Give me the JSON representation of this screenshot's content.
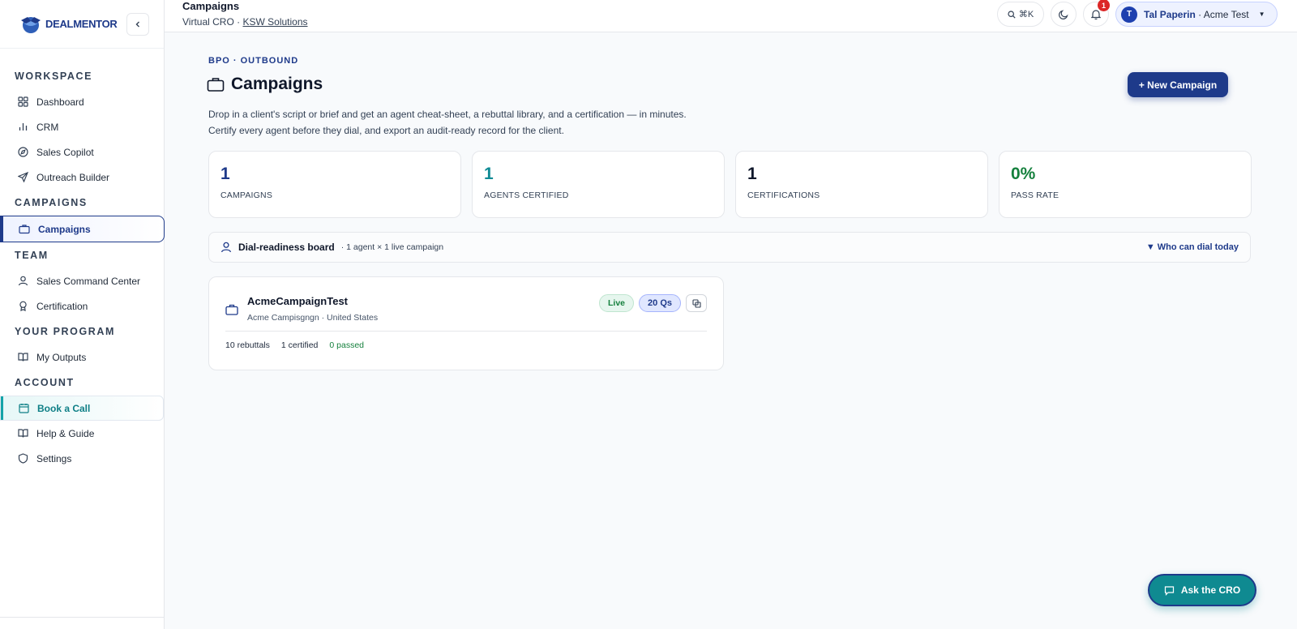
{
  "brand": {
    "logo_text": "DEALMENTOR"
  },
  "sidebar": {
    "sections": [
      {
        "title": "WORKSPACE",
        "items": [
          {
            "label": "Dashboard",
            "icon": "grid-icon"
          },
          {
            "label": "CRM",
            "icon": "bar-chart-icon"
          },
          {
            "label": "Sales Copilot",
            "icon": "compass-icon"
          },
          {
            "label": "Outreach Builder",
            "icon": "send-icon"
          }
        ]
      },
      {
        "title": "CAMPAIGNS",
        "items": [
          {
            "label": "Campaigns",
            "icon": "briefcase-icon",
            "active": true
          }
        ]
      },
      {
        "title": "TEAM",
        "items": [
          {
            "label": "Sales Command Center",
            "icon": "user-icon"
          },
          {
            "label": "Certification",
            "icon": "award-icon"
          }
        ]
      },
      {
        "title": "YOUR PROGRAM",
        "items": [
          {
            "label": "My Outputs",
            "icon": "book-open-icon"
          }
        ]
      },
      {
        "title": "ACCOUNT",
        "items": [
          {
            "label": "Book a Call",
            "icon": "calendar-icon",
            "highlight": true
          },
          {
            "label": "Help & Guide",
            "icon": "book-open-icon"
          },
          {
            "label": "Settings",
            "icon": "shield-icon"
          }
        ]
      }
    ]
  },
  "topbar": {
    "title": "Campaigns",
    "subtitle_prefix": "Virtual CRO · ",
    "subtitle_link": "KSW Solutions",
    "search_shortcut": "⌘K",
    "notification_count": "1",
    "user": {
      "initial": "T",
      "name": "Tal Paperin",
      "org": " · Acme Test"
    }
  },
  "main": {
    "eyebrow": "BPO · OUTBOUND",
    "title": "Campaigns",
    "new_button": "+ New Campaign",
    "description_line1": "Drop in a client's script or brief and get an agent cheat-sheet, a rebuttal library, and a certification — in minutes.",
    "description_line2": "Certify every agent before they dial, and export an audit-ready record for the client.",
    "stats": [
      {
        "value": "1",
        "label": "CAMPAIGNS",
        "color": "#1e3a8a"
      },
      {
        "value": "1",
        "label": "AGENTS CERTIFIED",
        "color": "#0e8a94"
      },
      {
        "value": "1",
        "label": "CERTIFICATIONS",
        "color": "#0f172a"
      },
      {
        "value": "0%",
        "label": "PASS RATE",
        "color": "#15803d"
      }
    ],
    "board": {
      "title": "Dial-readiness board",
      "meta": "· 1 agent × 1 live campaign",
      "toggle": "▼ Who can dial today"
    },
    "campaign_card": {
      "title": "AcmeCampaignTest",
      "subtitle": "Acme Campisgngn · United States",
      "status": "Live",
      "questions": "20 Qs",
      "rebuttals": "10 rebuttals",
      "certified": "1 certified",
      "passed": "0 passed"
    },
    "ask_button": "Ask the CRO"
  }
}
